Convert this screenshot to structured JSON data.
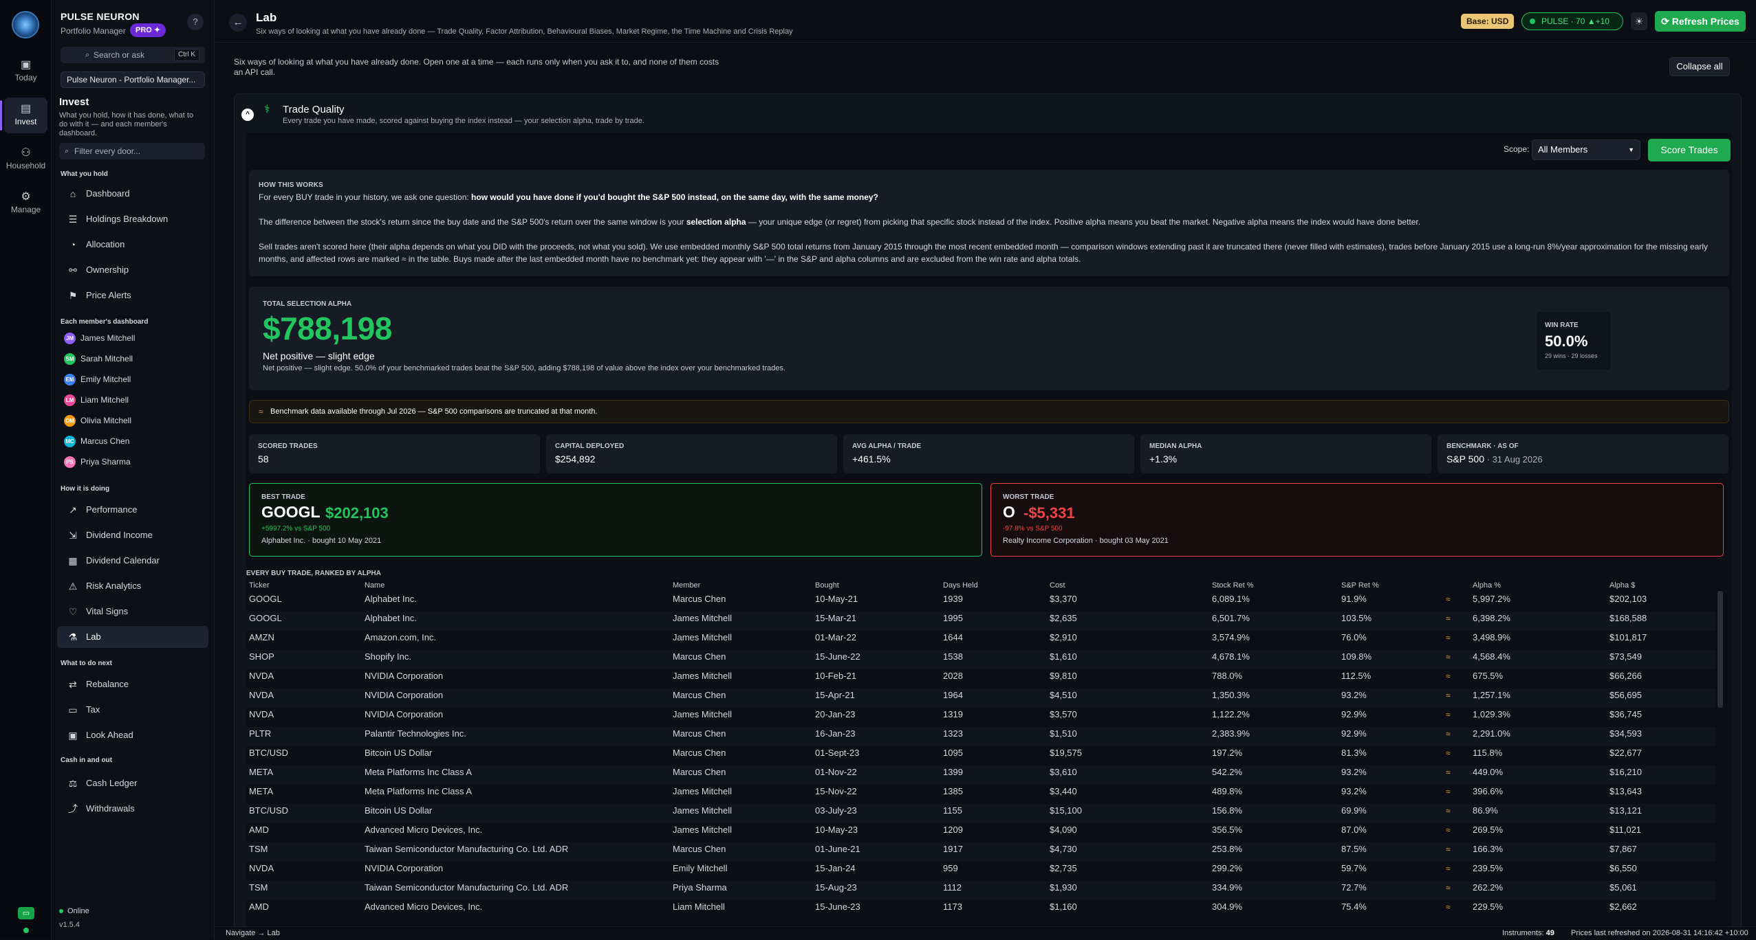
{
  "app": {
    "brand": "PULSE NEURON",
    "role": "Portfolio Manager",
    "badge": "PRO ✦",
    "help": "?"
  },
  "rail": [
    {
      "label": "Today",
      "icon": "▣"
    },
    {
      "label": "Invest",
      "icon": "▤"
    },
    {
      "label": "Household",
      "icon": "⚇"
    },
    {
      "label": "Manage",
      "icon": "⚙"
    }
  ],
  "sidebar": {
    "search_label": "Search or ask",
    "search_kbd": "Ctrl K",
    "portfolio": "Pulse Neuron - Portfolio Manager...",
    "section_title": "Invest",
    "section_desc": "What you hold, how it has done, what to do with it — and each member's dashboard.",
    "filter_placeholder": "Filter every door...",
    "groups": {
      "hold": "What you hold",
      "members": "Each member's dashboard",
      "doing": "How it is doing",
      "next": "What to do next",
      "cash": "Cash in and out"
    },
    "hold_items": [
      {
        "label": "Dashboard",
        "icon": "⌂"
      },
      {
        "label": "Holdings Breakdown",
        "icon": "☰"
      },
      {
        "label": "Allocation",
        "icon": "◔"
      },
      {
        "label": "Ownership",
        "icon": "⚯"
      },
      {
        "label": "Price Alerts",
        "icon": "⚑"
      }
    ],
    "members": [
      {
        "initials": "JM",
        "name": "James Mitchell",
        "color": "#8b5cf6"
      },
      {
        "initials": "SM",
        "name": "Sarah Mitchell",
        "color": "#22c55e"
      },
      {
        "initials": "EM",
        "name": "Emily Mitchell",
        "color": "#3b82f6"
      },
      {
        "initials": "LM",
        "name": "Liam Mitchell",
        "color": "#ec4899"
      },
      {
        "initials": "OM",
        "name": "Olivia Mitchell",
        "color": "#f59e0b"
      },
      {
        "initials": "MC",
        "name": "Marcus Chen",
        "color": "#06b6d4"
      },
      {
        "initials": "PS",
        "name": "Priya Sharma",
        "color": "#f472b6"
      }
    ],
    "doing_items": [
      {
        "label": "Performance",
        "icon": "↗"
      },
      {
        "label": "Dividend Income",
        "icon": "⇲"
      },
      {
        "label": "Dividend Calendar",
        "icon": "▦"
      },
      {
        "label": "Risk Analytics",
        "icon": "⚠"
      },
      {
        "label": "Vital Signs",
        "icon": "♡"
      },
      {
        "label": "Lab",
        "icon": "⚗"
      }
    ],
    "next_items": [
      {
        "label": "Rebalance",
        "icon": "⇄"
      },
      {
        "label": "Tax",
        "icon": "▭"
      },
      {
        "label": "Look Ahead",
        "icon": "▣"
      }
    ],
    "cash_items": [
      {
        "label": "Cash Ledger",
        "icon": "⚖"
      },
      {
        "label": "Withdrawals",
        "icon": "⤴"
      }
    ],
    "status": "Online",
    "version": "v1.5.4"
  },
  "header": {
    "back": "←",
    "title": "Lab",
    "subtitle": "Six ways of looking at what you have already done — Trade Quality, Factor Attribution, Behavioural Biases, Market Regime, the Time Machine and Crisis Replay",
    "base": "Base: USD",
    "pulse": "PULSE · 70  ▲+10",
    "theme_icon": "☀",
    "refresh": "⟳ Refresh Prices"
  },
  "main": {
    "intro": "Six ways of looking at what you have already done. Open one at a time — each runs only when you ask it to, and none of them costs an API call.",
    "collapse_all": "Collapse all",
    "card": {
      "toggle": "^",
      "icon": "⚕",
      "title": "Trade Quality",
      "subtitle": "Every trade you have made, scored against buying the index instead — your selection alpha, trade by trade.",
      "scope_label": "Scope:",
      "scope_value": "All Members",
      "score_button": "Score Trades",
      "how": {
        "heading": "HOW THIS WORKS",
        "p1_a": "For every BUY trade in your history, we ask one question: ",
        "p1_b": "how would you have done if you'd bought the S&P 500 instead, on the same day, with the same money?",
        "p2_a": "The difference between the stock's return since the buy date and the S&P 500's return over the same window is your ",
        "p2_b": "selection alpha",
        "p2_c": " — your unique edge (or regret) from picking that specific stock instead of the index. Positive alpha means you beat the market. Negative alpha means the index would have done better.",
        "p3": "Sell trades aren't scored here (their alpha depends on what you DID with the proceeds, not what you sold). We use embedded monthly S&P 500 total returns from January 2015 through the most recent embedded month — comparison windows extending past it are truncated there (never filled with estimates), trades before January 2015 use a long-run 8%/year approximation for the missing early months, and affected rows are marked ≈ in the table. Buys made after the last embedded month have no benchmark yet: they appear with '—' in the S&P and alpha columns and are excluded from the win rate and alpha totals."
      },
      "alpha": {
        "label": "TOTAL SELECTION ALPHA",
        "value": "$788,198",
        "verdict": "Net positive — slight edge",
        "detail": "Net positive — slight edge. 50.0% of your benchmarked trades beat the S&P 500, adding $788,198 of value above the index over your benchmarked trades.",
        "win_label": "WIN RATE",
        "win_value": "50.0%",
        "win_sub": "29 wins · 29 losses"
      },
      "bench_note": "Benchmark data available through Jul 2026 — S&P 500 comparisons are truncated at that month.",
      "bench_icon": "≈",
      "stats": [
        {
          "label": "SCORED TRADES",
          "value": "58",
          "extra": ""
        },
        {
          "label": "CAPITAL DEPLOYED",
          "value": "$254,892",
          "extra": ""
        },
        {
          "label": "AVG ALPHA / TRADE",
          "value": "+461.5%",
          "extra": ""
        },
        {
          "label": "MEDIAN ALPHA",
          "value": "+1.3%",
          "extra": ""
        },
        {
          "label": "BENCHMARK · AS OF",
          "value": "S&P 500",
          "extra": " · 31 Aug 2026"
        }
      ],
      "best": {
        "label": "BEST TRADE",
        "ticker": "GOOGL",
        "amount": "$202,103",
        "pct": "+5997.2% vs S&P 500",
        "note": "Alphabet Inc. · bought 10 May 2021"
      },
      "worst": {
        "label": "WORST TRADE",
        "ticker": "O",
        "amount": "-$5,331",
        "pct": "-97.8% vs S&P 500",
        "note": "Realty Income Corporation · bought 03 May 2021"
      },
      "table": {
        "title": "EVERY BUY TRADE, RANKED BY ALPHA",
        "columns": [
          "Ticker",
          "Name",
          "Member",
          "Bought",
          "Days Held",
          "Cost",
          "Stock Ret %",
          "S&P Ret %",
          "Alpha %",
          "Alpha $"
        ],
        "rows": [
          [
            "GOOGL",
            "Alphabet Inc.",
            "Marcus Chen",
            "10-May-21",
            "1939",
            "$3,370",
            "6,089.1%",
            "91.9%",
            "≈",
            "5,997.2%",
            "$202,103"
          ],
          [
            "GOOGL",
            "Alphabet Inc.",
            "James Mitchell",
            "15-Mar-21",
            "1995",
            "$2,635",
            "6,501.7%",
            "103.5%",
            "≈",
            "6,398.2%",
            "$168,588"
          ],
          [
            "AMZN",
            "Amazon.com, Inc.",
            "James Mitchell",
            "01-Mar-22",
            "1644",
            "$2,910",
            "3,574.9%",
            "76.0%",
            "≈",
            "3,498.9%",
            "$101,817"
          ],
          [
            "SHOP",
            "Shopify Inc.",
            "Marcus Chen",
            "15-June-22",
            "1538",
            "$1,610",
            "4,678.1%",
            "109.8%",
            "≈",
            "4,568.4%",
            "$73,549"
          ],
          [
            "NVDA",
            "NVIDIA Corporation",
            "James Mitchell",
            "10-Feb-21",
            "2028",
            "$9,810",
            "788.0%",
            "112.5%",
            "≈",
            "675.5%",
            "$66,266"
          ],
          [
            "NVDA",
            "NVIDIA Corporation",
            "Marcus Chen",
            "15-Apr-21",
            "1964",
            "$4,510",
            "1,350.3%",
            "93.2%",
            "≈",
            "1,257.1%",
            "$56,695"
          ],
          [
            "NVDA",
            "NVIDIA Corporation",
            "James Mitchell",
            "20-Jan-23",
            "1319",
            "$3,570",
            "1,122.2%",
            "92.9%",
            "≈",
            "1,029.3%",
            "$36,745"
          ],
          [
            "PLTR",
            "Palantir Technologies Inc.",
            "Marcus Chen",
            "16-Jan-23",
            "1323",
            "$1,510",
            "2,383.9%",
            "92.9%",
            "≈",
            "2,291.0%",
            "$34,593"
          ],
          [
            "BTC/USD",
            "Bitcoin US Dollar",
            "Marcus Chen",
            "01-Sept-23",
            "1095",
            "$19,575",
            "197.2%",
            "81.3%",
            "≈",
            "115.8%",
            "$22,677"
          ],
          [
            "META",
            "Meta Platforms Inc Class A",
            "Marcus Chen",
            "01-Nov-22",
            "1399",
            "$3,610",
            "542.2%",
            "93.2%",
            "≈",
            "449.0%",
            "$16,210"
          ],
          [
            "META",
            "Meta Platforms Inc Class A",
            "James Mitchell",
            "15-Nov-22",
            "1385",
            "$3,440",
            "489.8%",
            "93.2%",
            "≈",
            "396.6%",
            "$13,643"
          ],
          [
            "BTC/USD",
            "Bitcoin US Dollar",
            "James Mitchell",
            "03-July-23",
            "1155",
            "$15,100",
            "156.8%",
            "69.9%",
            "≈",
            "86.9%",
            "$13,121"
          ],
          [
            "AMD",
            "Advanced Micro Devices, Inc.",
            "James Mitchell",
            "10-May-23",
            "1209",
            "$4,090",
            "356.5%",
            "87.0%",
            "≈",
            "269.5%",
            "$11,021"
          ],
          [
            "TSM",
            "Taiwan Semiconductor Manufacturing Co. Ltd. ADR",
            "Marcus Chen",
            "01-June-21",
            "1917",
            "$4,730",
            "253.8%",
            "87.5%",
            "≈",
            "166.3%",
            "$7,867"
          ],
          [
            "NVDA",
            "NVIDIA Corporation",
            "Emily Mitchell",
            "15-Jan-24",
            "959",
            "$2,735",
            "299.2%",
            "59.7%",
            "≈",
            "239.5%",
            "$6,550"
          ],
          [
            "TSM",
            "Taiwan Semiconductor Manufacturing Co. Ltd. ADR",
            "Priya Sharma",
            "15-Aug-23",
            "1112",
            "$1,930",
            "334.9%",
            "72.7%",
            "≈",
            "262.2%",
            "$5,061"
          ],
          [
            "AMD",
            "Advanced Micro Devices, Inc.",
            "Liam Mitchell",
            "15-June-23",
            "1173",
            "$1,160",
            "304.9%",
            "75.4%",
            "≈",
            "229.5%",
            "$2,662"
          ]
        ]
      }
    }
  },
  "statusbar": {
    "hint": "Navigate → Lab",
    "instr_label": "Instruments:",
    "instr_value": "49",
    "refreshed": "Prices last refreshed on 2026-08-31 14:16:42 +10:00"
  }
}
